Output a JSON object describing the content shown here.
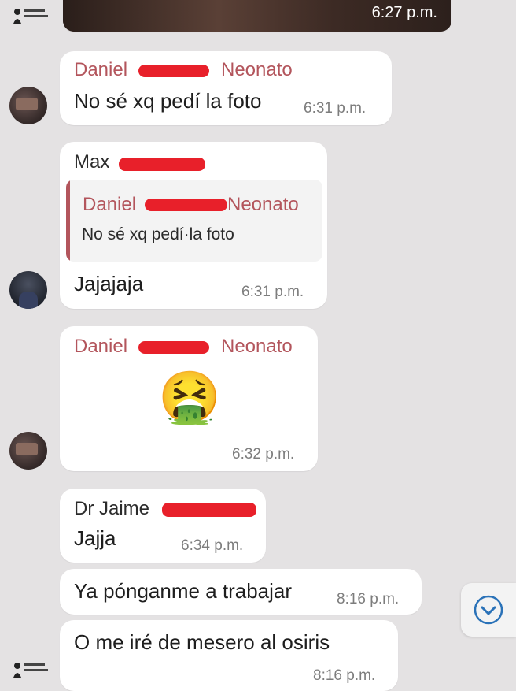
{
  "photo_message": {
    "time": "6:27 p.m."
  },
  "messages": [
    {
      "sender": "Daniel",
      "sender_tail": "Neonato",
      "text": "No sé xq pedí la foto",
      "time": "6:31 p.m."
    },
    {
      "sender": "Max",
      "reply_sender": "Daniel",
      "reply_sender_tail": "Neonato",
      "reply_text": "No sé xq pedí·la foto",
      "text": "Jajajaja",
      "time": "6:31 p.m."
    },
    {
      "sender": "Daniel",
      "sender_tail": "Neonato",
      "emoji": "🤮",
      "time": "6:32 p.m."
    },
    {
      "sender": "Dr Jaime",
      "text": "Jajja",
      "time": "6:34 p.m."
    },
    {
      "text": "Ya pónganme a trabajar",
      "time": "8:16 p.m."
    },
    {
      "text": "O me iré de mesero al osiris",
      "time": "8:16 p.m."
    }
  ],
  "icons": {
    "scroll_down": "chevron-down-icon",
    "logo": "dr-jaime-quesada-logo"
  },
  "colors": {
    "background": "#e4e2e3",
    "bubble": "#ffffff",
    "sender_name": "#b3555c",
    "redaction": "#e8202a",
    "scroll_button": "#2a72b8"
  }
}
